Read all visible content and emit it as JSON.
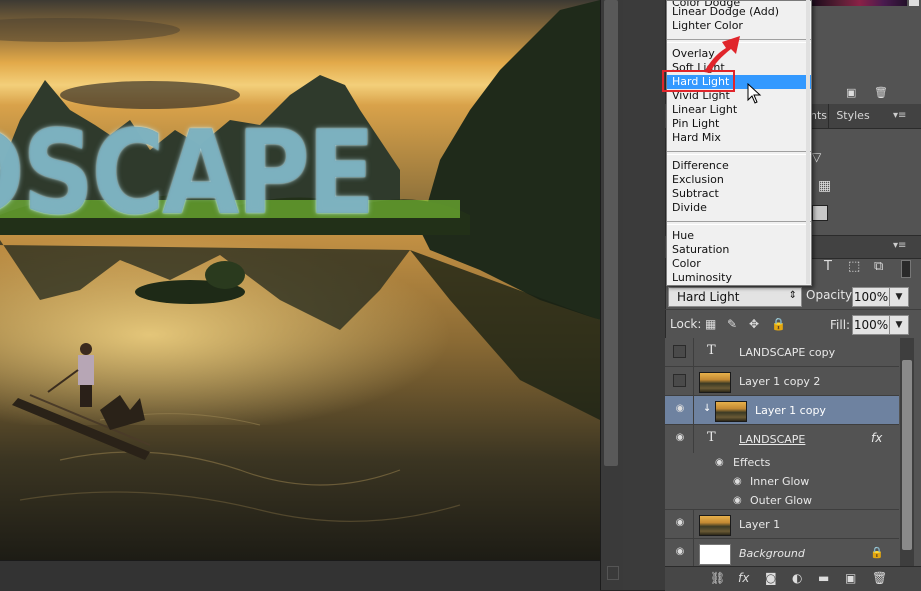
{
  "canvas": {
    "overlay_text": "DSCAPE"
  },
  "panel_tabs": {
    "adjustments_fragment": "nts",
    "styles": "Styles"
  },
  "blend_menu": {
    "group1": [
      "Linear Dodge (Add)",
      "Lighter Color"
    ],
    "group2": [
      "Overlay",
      "Soft Light",
      "Hard Light",
      "Vivid Light",
      "Linear Light",
      "Pin Light",
      "Hard Mix"
    ],
    "group3": [
      "Difference",
      "Exclusion",
      "Subtract",
      "Divide"
    ],
    "group4": [
      "Hue",
      "Saturation",
      "Color",
      "Luminosity"
    ],
    "highlighted": "Hard Light"
  },
  "layers_panel": {
    "blend_mode": "Hard Light",
    "opacity_label": "Opacity:",
    "opacity_value": "100%",
    "lock_label": "Lock:",
    "fill_label": "Fill:",
    "fill_value": "100%",
    "layers": [
      {
        "name": "LANDSCAPE copy",
        "kind": "text",
        "visible": false
      },
      {
        "name": "Layer 1 copy 2",
        "kind": "image",
        "visible": false
      },
      {
        "name": "Layer 1 copy",
        "kind": "image",
        "visible": true,
        "selected": true,
        "clipped": true
      },
      {
        "name": "LANDSCAPE",
        "kind": "text",
        "visible": true,
        "fx": "fx"
      },
      {
        "name": "Layer 1",
        "kind": "image",
        "visible": true
      },
      {
        "name": "Background",
        "kind": "white",
        "visible": true,
        "locked": true
      }
    ],
    "effects_label": "Effects",
    "effects": [
      "Inner Glow",
      "Outer Glow"
    ]
  },
  "colors": {
    "selection_highlight": "#3399ff",
    "layer_selected": "#6e82a0",
    "annotation_red": "#e0252b"
  }
}
